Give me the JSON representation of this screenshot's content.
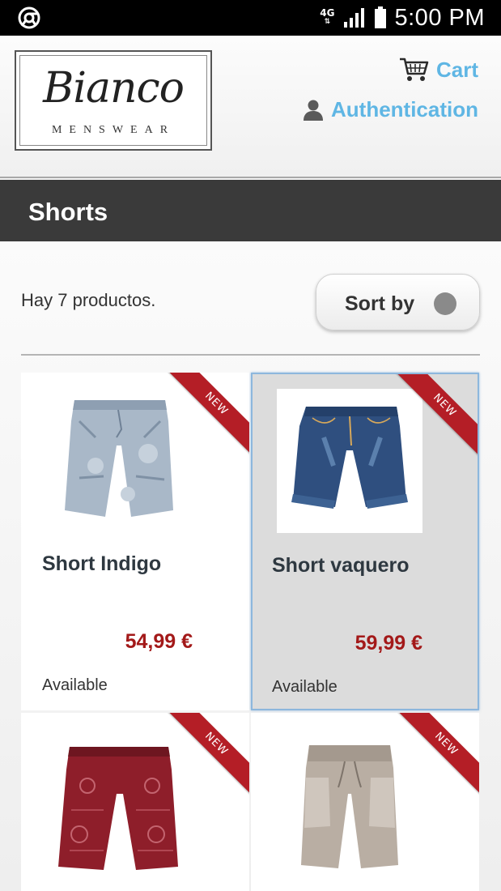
{
  "status_bar": {
    "network": "4G",
    "time": "5:00 PM",
    "icons": [
      "chrome-icon",
      "signal-icon",
      "battery-icon"
    ]
  },
  "header": {
    "logo_script": "Bianco",
    "logo_sub": "MENSWEAR",
    "cart_label": "Cart",
    "auth_label": "Authentication",
    "link_color": "#5fb6e4"
  },
  "category": {
    "title": "Shorts"
  },
  "listing": {
    "count_text": "Hay 7 productos.",
    "sort_label": "Sort by"
  },
  "products": [
    {
      "name": "Short Indigo",
      "price": "54,99 €",
      "availability": "Available",
      "badge": "NEW"
    },
    {
      "name": "Short vaquero",
      "price": "59,99 €",
      "availability": "Available",
      "badge": "NEW"
    },
    {
      "name": "",
      "price": "",
      "availability": "",
      "badge": "NEW"
    },
    {
      "name": "",
      "price": "",
      "availability": "",
      "badge": "NEW"
    }
  ],
  "colors": {
    "badge": "#b41e26",
    "price": "#a31919",
    "category_bar": "#3a3a3a"
  }
}
